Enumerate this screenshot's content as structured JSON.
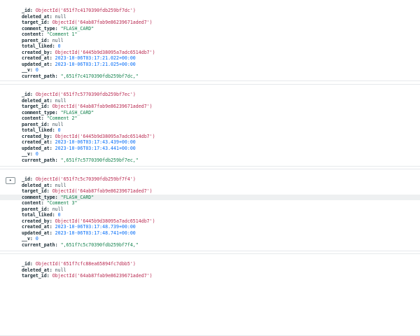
{
  "documents": [
    {
      "show_expand": false,
      "highlight_field": "",
      "fields": [
        {
          "key": "_id",
          "value": "ObjectId('651f7c4170390fdb259bf7dc')",
          "type": "oid"
        },
        {
          "key": "deleted_at",
          "value": "null",
          "type": "null"
        },
        {
          "key": "target_id",
          "value": "ObjectId('64ab87fab9e86239671aded7')",
          "type": "oid"
        },
        {
          "key": "comment_type",
          "value": "\"FLASH_CARD\"",
          "type": "str"
        },
        {
          "key": "content",
          "value": "\"Comment 1\"",
          "type": "str"
        },
        {
          "key": "parent_id",
          "value": "null",
          "type": "null"
        },
        {
          "key": "total_liked",
          "value": "0",
          "type": "num"
        },
        {
          "key": "created_by",
          "value": "ObjectId('6445b9d38095a7adc6514db7')",
          "type": "oid"
        },
        {
          "key": "created_at",
          "value": "2023-10-06T03:17:21.022+00:00",
          "type": "date"
        },
        {
          "key": "updated_at",
          "value": "2023-10-06T03:17:21.025+00:00",
          "type": "date"
        },
        {
          "key": "__v",
          "value": "0",
          "type": "num"
        },
        {
          "key": "current_path",
          "value": "\",651f7c4170390fdb259bf7dc,\"",
          "type": "str"
        }
      ]
    },
    {
      "show_expand": false,
      "highlight_field": "",
      "fields": [
        {
          "key": "_id",
          "value": "ObjectId('651f7c5770390fdb259bf7ec')",
          "type": "oid"
        },
        {
          "key": "deleted_at",
          "value": "null",
          "type": "null"
        },
        {
          "key": "target_id",
          "value": "ObjectId('64ab87fab9e86239671aded7')",
          "type": "oid"
        },
        {
          "key": "comment_type",
          "value": "\"FLASH_CARD\"",
          "type": "str"
        },
        {
          "key": "content",
          "value": "\"Comment 2\"",
          "type": "str"
        },
        {
          "key": "parent_id",
          "value": "null",
          "type": "null"
        },
        {
          "key": "total_liked",
          "value": "0",
          "type": "num"
        },
        {
          "key": "created_by",
          "value": "ObjectId('6445b9d38095a7adc6514db7')",
          "type": "oid"
        },
        {
          "key": "created_at",
          "value": "2023-10-06T03:17:43.439+00:00",
          "type": "date"
        },
        {
          "key": "updated_at",
          "value": "2023-10-06T03:17:43.441+00:00",
          "type": "date"
        },
        {
          "key": "__v",
          "value": "0",
          "type": "num"
        },
        {
          "key": "current_path",
          "value": "\",651f7c5770390fdb259bf7ec,\"",
          "type": "str"
        }
      ]
    },
    {
      "show_expand": true,
      "expand_glyph": "▸",
      "highlight_field": "comment_type",
      "fields": [
        {
          "key": "_id",
          "value": "ObjectId('651f7c5c70390fdb259bf7f4')",
          "type": "oid"
        },
        {
          "key": "deleted_at",
          "value": "null",
          "type": "null"
        },
        {
          "key": "target_id",
          "value": "ObjectId('64ab87fab9e86239671aded7')",
          "type": "oid"
        },
        {
          "key": "comment_type",
          "value": "\"FLASH_CARD\"",
          "type": "str"
        },
        {
          "key": "content",
          "value": "\"Comment 3\"",
          "type": "str"
        },
        {
          "key": "parent_id",
          "value": "null",
          "type": "null"
        },
        {
          "key": "total_liked",
          "value": "0",
          "type": "num"
        },
        {
          "key": "created_by",
          "value": "ObjectId('6445b9d38095a7adc6514db7')",
          "type": "oid"
        },
        {
          "key": "created_at",
          "value": "2023-10-06T03:17:48.739+00:00",
          "type": "date"
        },
        {
          "key": "updated_at",
          "value": "2023-10-06T03:17:48.741+00:00",
          "type": "date"
        },
        {
          "key": "__v",
          "value": "0",
          "type": "num"
        },
        {
          "key": "current_path",
          "value": "\",651f7c5c70390fdb259bf7f4,\"",
          "type": "str"
        }
      ]
    },
    {
      "show_expand": false,
      "highlight_field": "",
      "fields": [
        {
          "key": "_id",
          "value": "ObjectId('651f7cfc88ea65894fc7dbb5')",
          "type": "oid"
        },
        {
          "key": "deleted_at",
          "value": "null",
          "type": "null"
        },
        {
          "key": "target_id",
          "value": "ObjectId('64ab87fab9e86239671aded7')",
          "type": "oid"
        }
      ]
    }
  ]
}
